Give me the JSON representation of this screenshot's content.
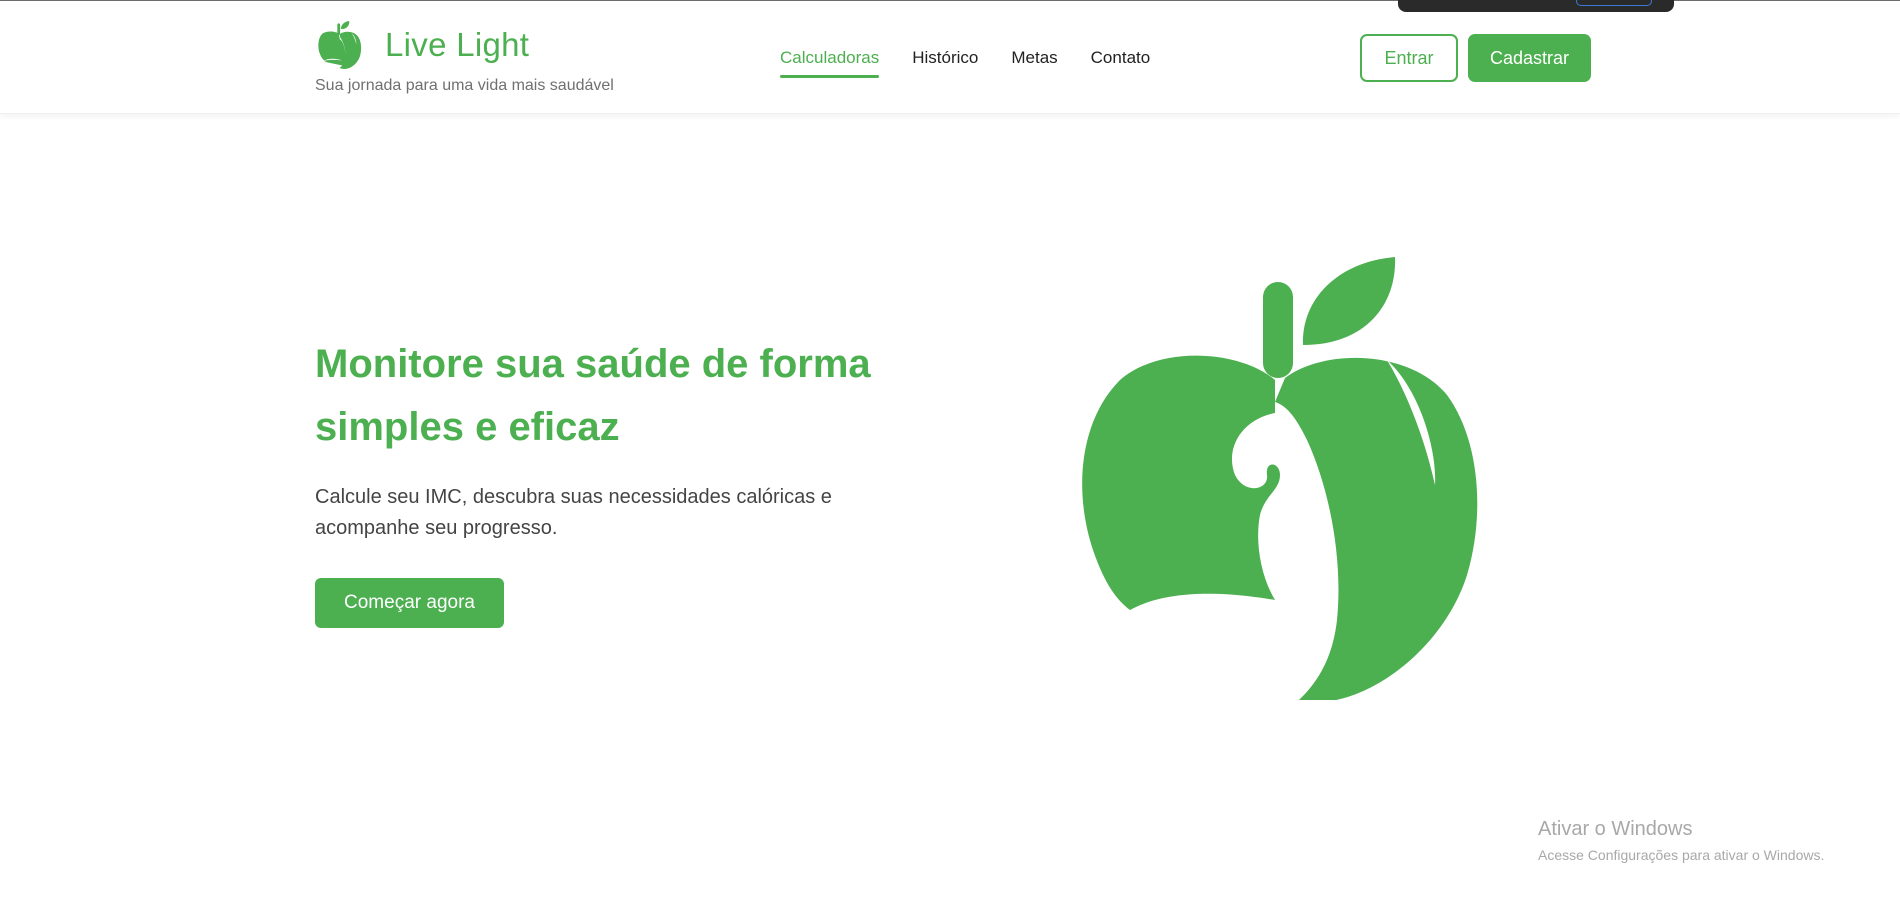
{
  "brand": {
    "name": "Live Light",
    "tagline": "Sua jornada para uma vida mais saudável",
    "logo_icon": "apple-muscle-icon",
    "accent_color": "#4caf50"
  },
  "nav": {
    "items": [
      {
        "label": "Calculadoras",
        "active": true
      },
      {
        "label": "Histórico",
        "active": false
      },
      {
        "label": "Metas",
        "active": false
      },
      {
        "label": "Contato",
        "active": false
      }
    ]
  },
  "auth": {
    "login_label": "Entrar",
    "signup_label": "Cadastrar"
  },
  "hero": {
    "title": "Monitore sua saúde de forma simples e eficaz",
    "subtitle": "Calcule seu IMC, descubra suas necessidades calóricas e acompanhe seu progresso.",
    "cta_label": "Começar agora",
    "illustration_icon": "apple-muscle-icon"
  },
  "watermark": {
    "title": "Ativar o Windows",
    "subtitle": "Acesse Configurações para ativar o Windows."
  }
}
